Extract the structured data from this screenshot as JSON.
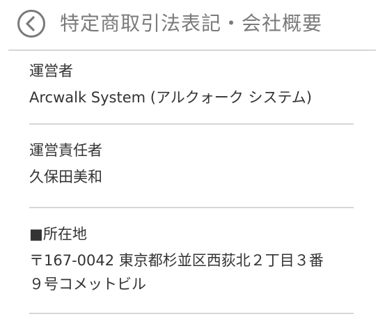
{
  "header": {
    "title": "特定商取引法表記・会社概要",
    "back_icon": "chevron-left-circle-icon",
    "icon_color": "#7a7a7a"
  },
  "sections": [
    {
      "label": "運営者",
      "value": "Arcwalk System (アルクォーク システム)"
    },
    {
      "label": "運営責任者",
      "value": "久保田美和"
    },
    {
      "label": "■所在地",
      "value_lines": [
        "〒167-0042 東京都杉並区西荻北２丁目３番",
        "９号コメットビル"
      ]
    }
  ]
}
